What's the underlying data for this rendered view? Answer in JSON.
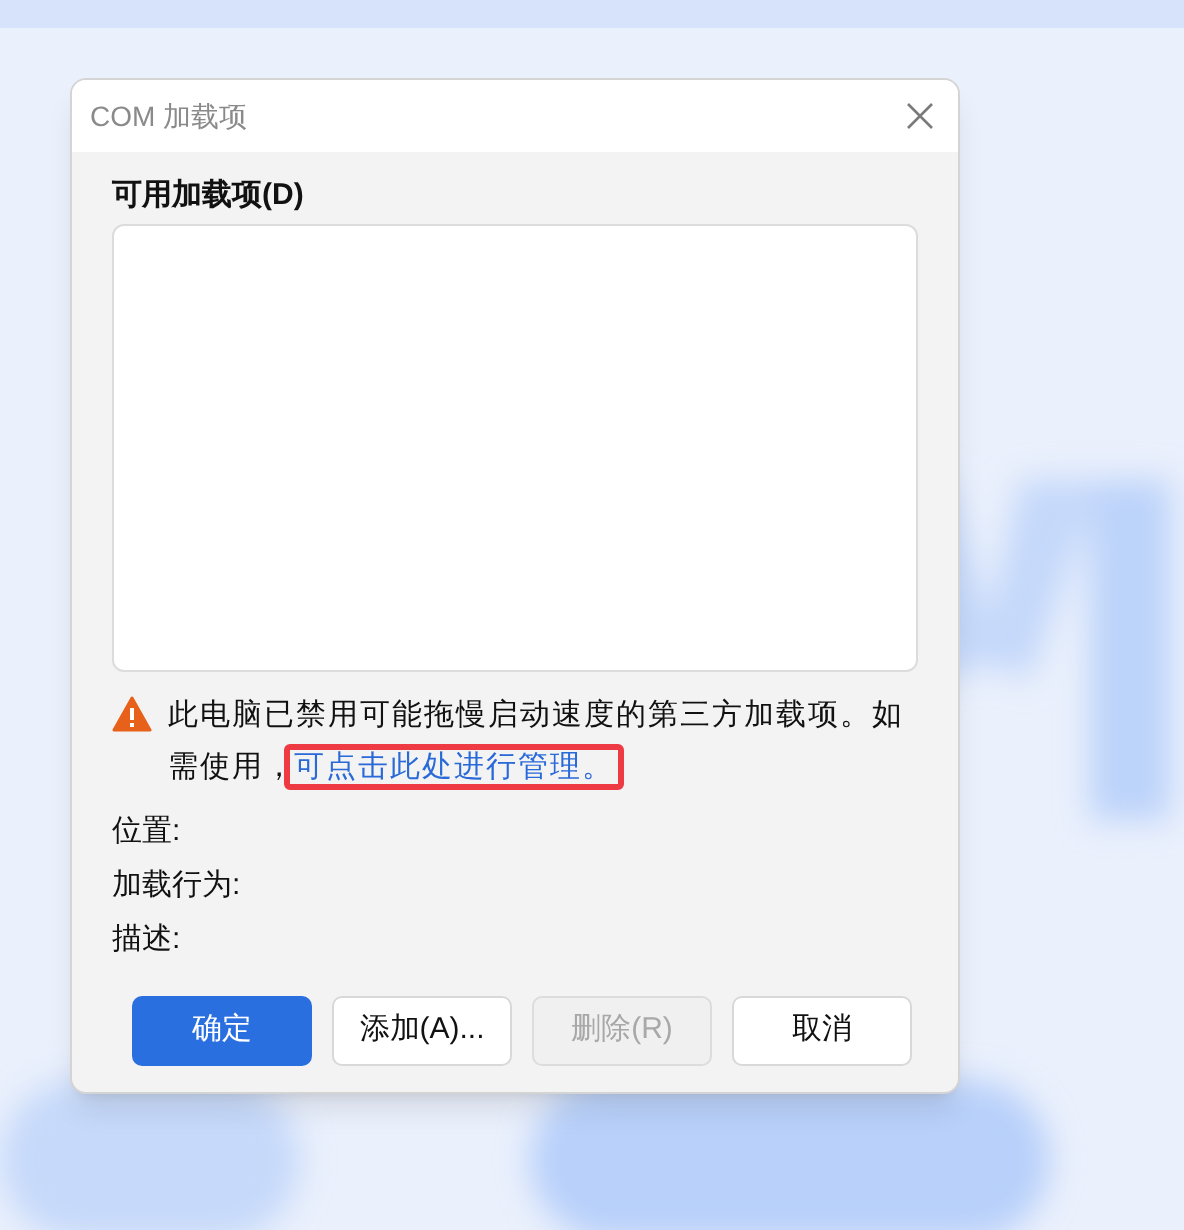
{
  "window": {
    "title": "COM 加载项"
  },
  "list": {
    "label": "可用加载项(D)"
  },
  "warning": {
    "text": "此电脑已禁用可能拖慢启动速度的第三方加载项。如需使用，",
    "link": "可点击此处进行管理。",
    "highlighted": true
  },
  "details": [
    {
      "label": "位置:"
    },
    {
      "label": "加载行为:"
    },
    {
      "label": "描述:"
    }
  ],
  "buttons": [
    {
      "label": "确定",
      "kind": "primary",
      "disabled": false
    },
    {
      "label": "添加(A)...",
      "kind": "normal",
      "disabled": false
    },
    {
      "label": "删除(R)",
      "kind": "normal",
      "disabled": true
    },
    {
      "label": "取消",
      "kind": "normal",
      "disabled": false
    }
  ]
}
